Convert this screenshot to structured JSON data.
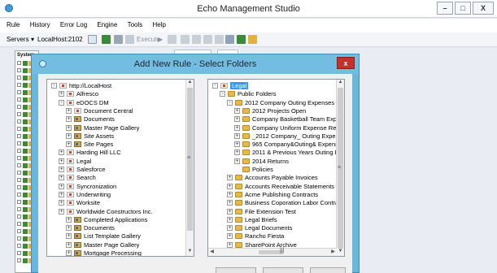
{
  "window": {
    "title": "Echo Management Studio",
    "controls": {
      "minimize": "–",
      "maximize": "□",
      "close": "X"
    }
  },
  "menu": [
    "Rule",
    "History",
    "Error Log",
    "Engine",
    "Tools",
    "Help"
  ],
  "toolbar": {
    "servers_label": "Servers",
    "server_value": "LocalHost:2102",
    "execute_label": "Execute"
  },
  "left_panel": {
    "title": "System"
  },
  "dialog": {
    "title": "Add New Rule - Select Folders",
    "close_label": "x",
    "left_tree": [
      {
        "label": "http://LocalHost",
        "icon": "site-icon",
        "exp": "-"
      },
      {
        "label": "Alfresco",
        "icon": "site-icon",
        "exp": "+"
      },
      {
        "label": "eDOCS DM",
        "icon": "site-icon",
        "exp": "-"
      },
      {
        "label": "Document Central",
        "icon": "site-icon",
        "exp": "+"
      },
      {
        "label": "Documents",
        "icon": "library-icon",
        "exp": "+"
      },
      {
        "label": "Master Page Gallery",
        "icon": "library-icon",
        "exp": "+"
      },
      {
        "label": "Site Assets",
        "icon": "library-icon",
        "exp": "+"
      },
      {
        "label": "Site Pages",
        "icon": "library-icon",
        "exp": "+"
      },
      {
        "label": "Harding Hill LLC",
        "icon": "site-icon",
        "exp": "+"
      },
      {
        "label": "Legal",
        "icon": "site-icon",
        "exp": "+"
      },
      {
        "label": "Salesforce",
        "icon": "site-icon",
        "exp": "+"
      },
      {
        "label": "Search",
        "icon": "site-icon",
        "exp": "+"
      },
      {
        "label": "Syncronization",
        "icon": "site-icon",
        "exp": "+"
      },
      {
        "label": "Underwriting",
        "icon": "site-icon",
        "exp": "+"
      },
      {
        "label": "Worksite",
        "icon": "site-icon",
        "exp": "+"
      },
      {
        "label": "Worldwide Constructors Inc.",
        "icon": "site-icon",
        "exp": "+"
      },
      {
        "label": "Completed Applications",
        "icon": "library-icon",
        "exp": "+"
      },
      {
        "label": "Documents",
        "icon": "library-icon",
        "exp": "+"
      },
      {
        "label": "List Template Gallery",
        "icon": "library-icon",
        "exp": "+"
      },
      {
        "label": "Master Page Gallery",
        "icon": "library-icon",
        "exp": "+"
      },
      {
        "label": "Mortgage Processing",
        "icon": "library-icon",
        "exp": "+"
      }
    ],
    "right_tree": [
      {
        "label": "Legal",
        "icon": "site-icon",
        "exp": "-"
      },
      {
        "label": "Public Folders",
        "icon": "folder-icon",
        "exp": "-"
      },
      {
        "label": "2012 Company Outing Expenses",
        "icon": "folder-icon",
        "exp": "-"
      },
      {
        "label": "2012 Projects Open",
        "icon": "folder-icon",
        "exp": "+"
      },
      {
        "label": "Company Basketball Team Expe",
        "icon": "folder-icon",
        "exp": "+"
      },
      {
        "label": "Company Uniform Expense Repc",
        "icon": "folder-icon",
        "exp": "+"
      },
      {
        "label": "_2012 Company_ Outing Expens",
        "icon": "folder-icon",
        "exp": "+"
      },
      {
        "label": "965 Company&Outing& Expense",
        "icon": "folder-icon",
        "exp": "+"
      },
      {
        "label": "2011 & Previous Years Outing Re",
        "icon": "folder-icon",
        "exp": "+"
      },
      {
        "label": "2014 Returns",
        "icon": "folder-icon",
        "exp": "+"
      },
      {
        "label": "Policies",
        "icon": "folder-icon",
        "exp": ""
      },
      {
        "label": "Accounts Payable Invoices",
        "icon": "folder-icon",
        "exp": "+"
      },
      {
        "label": "Accounts Receivable Statements",
        "icon": "folder-icon",
        "exp": "+"
      },
      {
        "label": "Acme Publishing Contracts",
        "icon": "folder-icon",
        "exp": "+"
      },
      {
        "label": "Business Coporation Labor Contracts",
        "icon": "folder-icon",
        "exp": "+"
      },
      {
        "label": "File Extension Test",
        "icon": "folder-icon",
        "exp": "+"
      },
      {
        "label": "Legal Briefs",
        "icon": "folder-icon",
        "exp": "+"
      },
      {
        "label": "Legal Documents",
        "icon": "folder-icon",
        "exp": "+"
      },
      {
        "label": "Rancho Fiesta",
        "icon": "folder-icon",
        "exp": "+"
      },
      {
        "label": "SharePoint Archive",
        "icon": "folder-icon",
        "exp": "+"
      }
    ],
    "scroll_grip": "≡",
    "hscroll_grip": "|||"
  },
  "colors": {
    "dialog_frame": "#6ab6dc",
    "selection": "#3399ff",
    "close_red": "#c4312b"
  }
}
